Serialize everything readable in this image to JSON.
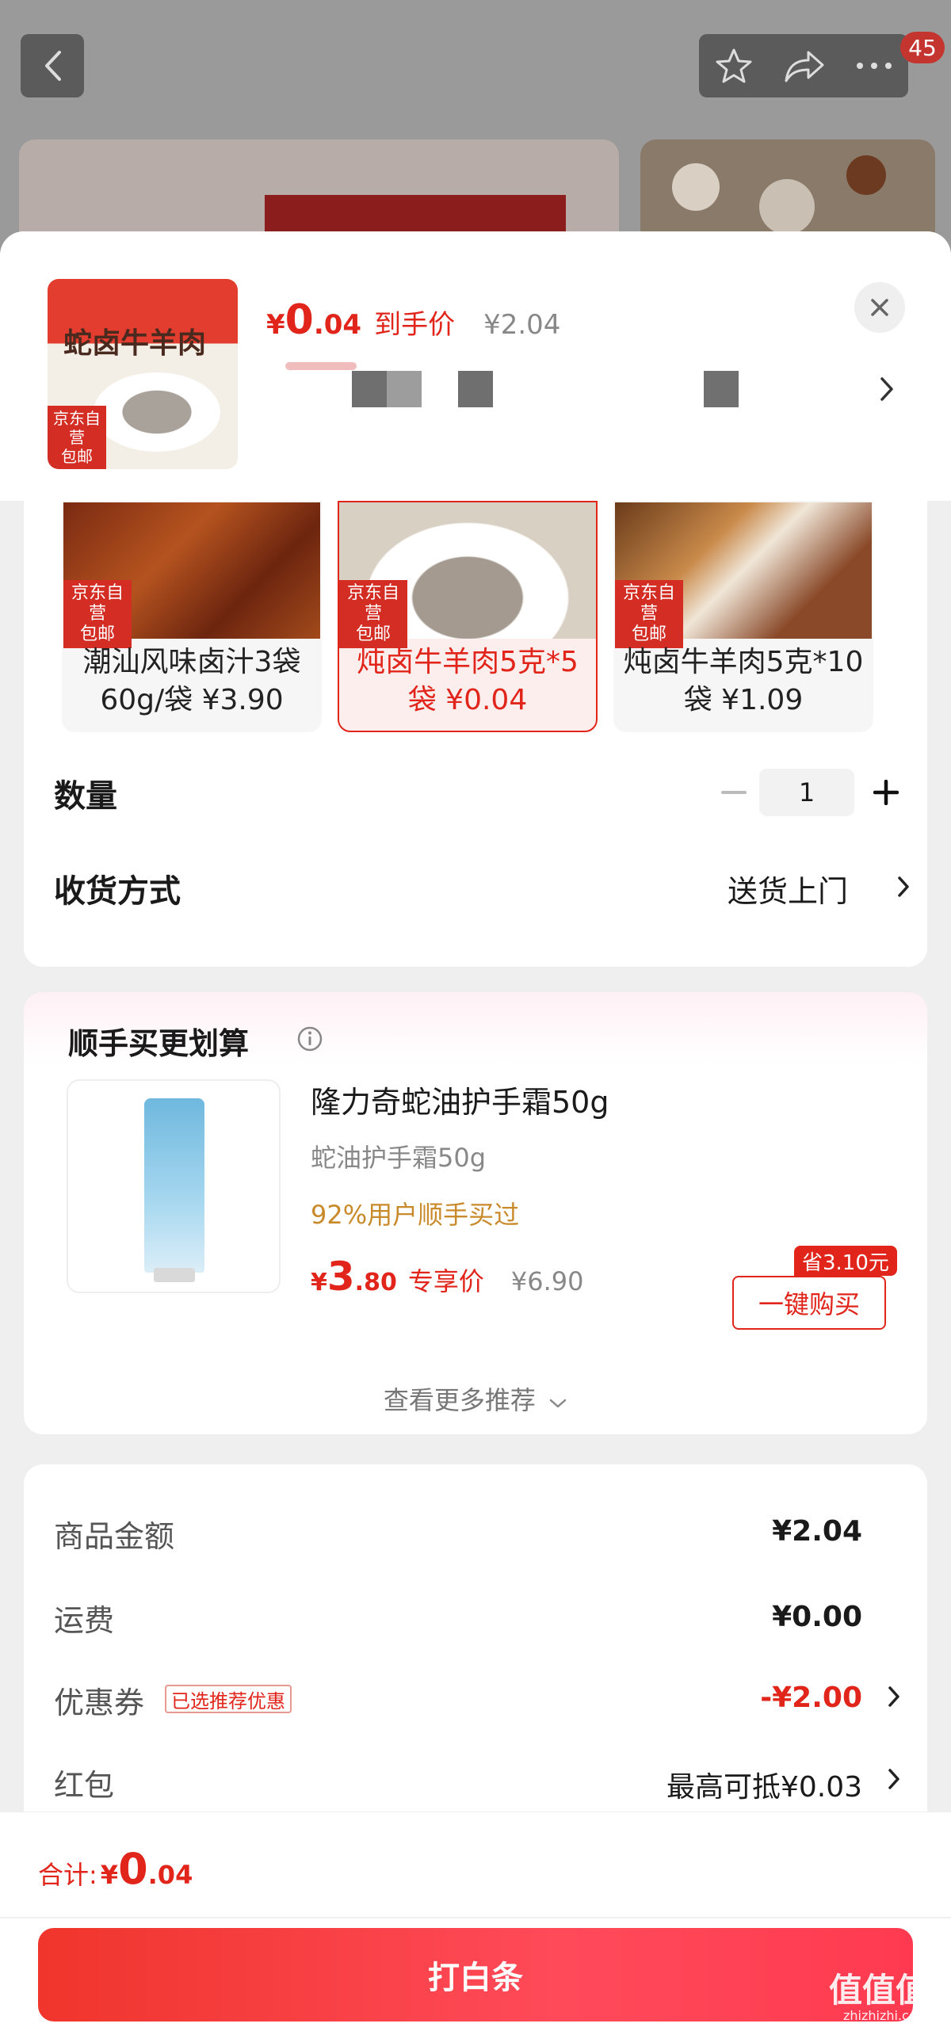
{
  "header": {
    "cart_count": "45"
  },
  "product": {
    "thumb_pkg_text": "蛇卤牛羊肉",
    "self_badge": "京东自营\n包邮",
    "price_currency": "¥",
    "price_int": "0",
    "price_dec": ".04",
    "price_tag": "到手价",
    "original_price": "¥2.04"
  },
  "variants": [
    {
      "badge": "京东自营\n包邮",
      "text": "潮汕风味卤汁3袋60g/袋 ¥3.90",
      "selected": false
    },
    {
      "badge": "京东自营\n包邮",
      "text": "炖卤牛羊肉5克*5袋 ¥0.04",
      "selected": true
    },
    {
      "badge": "京东自营\n包邮",
      "text": "炖卤牛羊肉5克*10袋 ¥1.09",
      "selected": false
    }
  ],
  "quantity": {
    "label": "数量",
    "value": "1"
  },
  "delivery": {
    "label": "收货方式",
    "value": "送货上门"
  },
  "recommend": {
    "title": "顺手买更划算",
    "item_name": "隆力奇蛇油护手霜50g",
    "item_spec": "蛇油护手霜50g",
    "item_stat": "92%用户顺手买过",
    "price_currency": "¥",
    "price_int": "3",
    "price_dec": ".80",
    "price_tag": "专享价",
    "original_price": "¥6.90",
    "save_badge": "省3.10元",
    "buy_label": "一键购买",
    "more_label": "查看更多推荐"
  },
  "summary": {
    "goods_label": "商品金额",
    "goods_value": "¥2.04",
    "shipping_label": "运费",
    "shipping_value": "¥0.00",
    "coupon_label": "优惠券",
    "coupon_badge": "已选推荐优惠",
    "coupon_value": "-¥2.00",
    "redpacket_label": "红包",
    "redpacket_value": "最高可抵¥0.03"
  },
  "bottom": {
    "total_label": "合计:",
    "total_currency": "¥",
    "total_int": "0",
    "total_dec": ".04",
    "pay_label": "打白条"
  },
  "watermark": {
    "main": "值值值",
    "sub": "zhizhizhi.com"
  },
  "colors": {
    "accent": "#e1251b",
    "badge": "#d32d24",
    "recommend_stat": "#c98a2b"
  }
}
